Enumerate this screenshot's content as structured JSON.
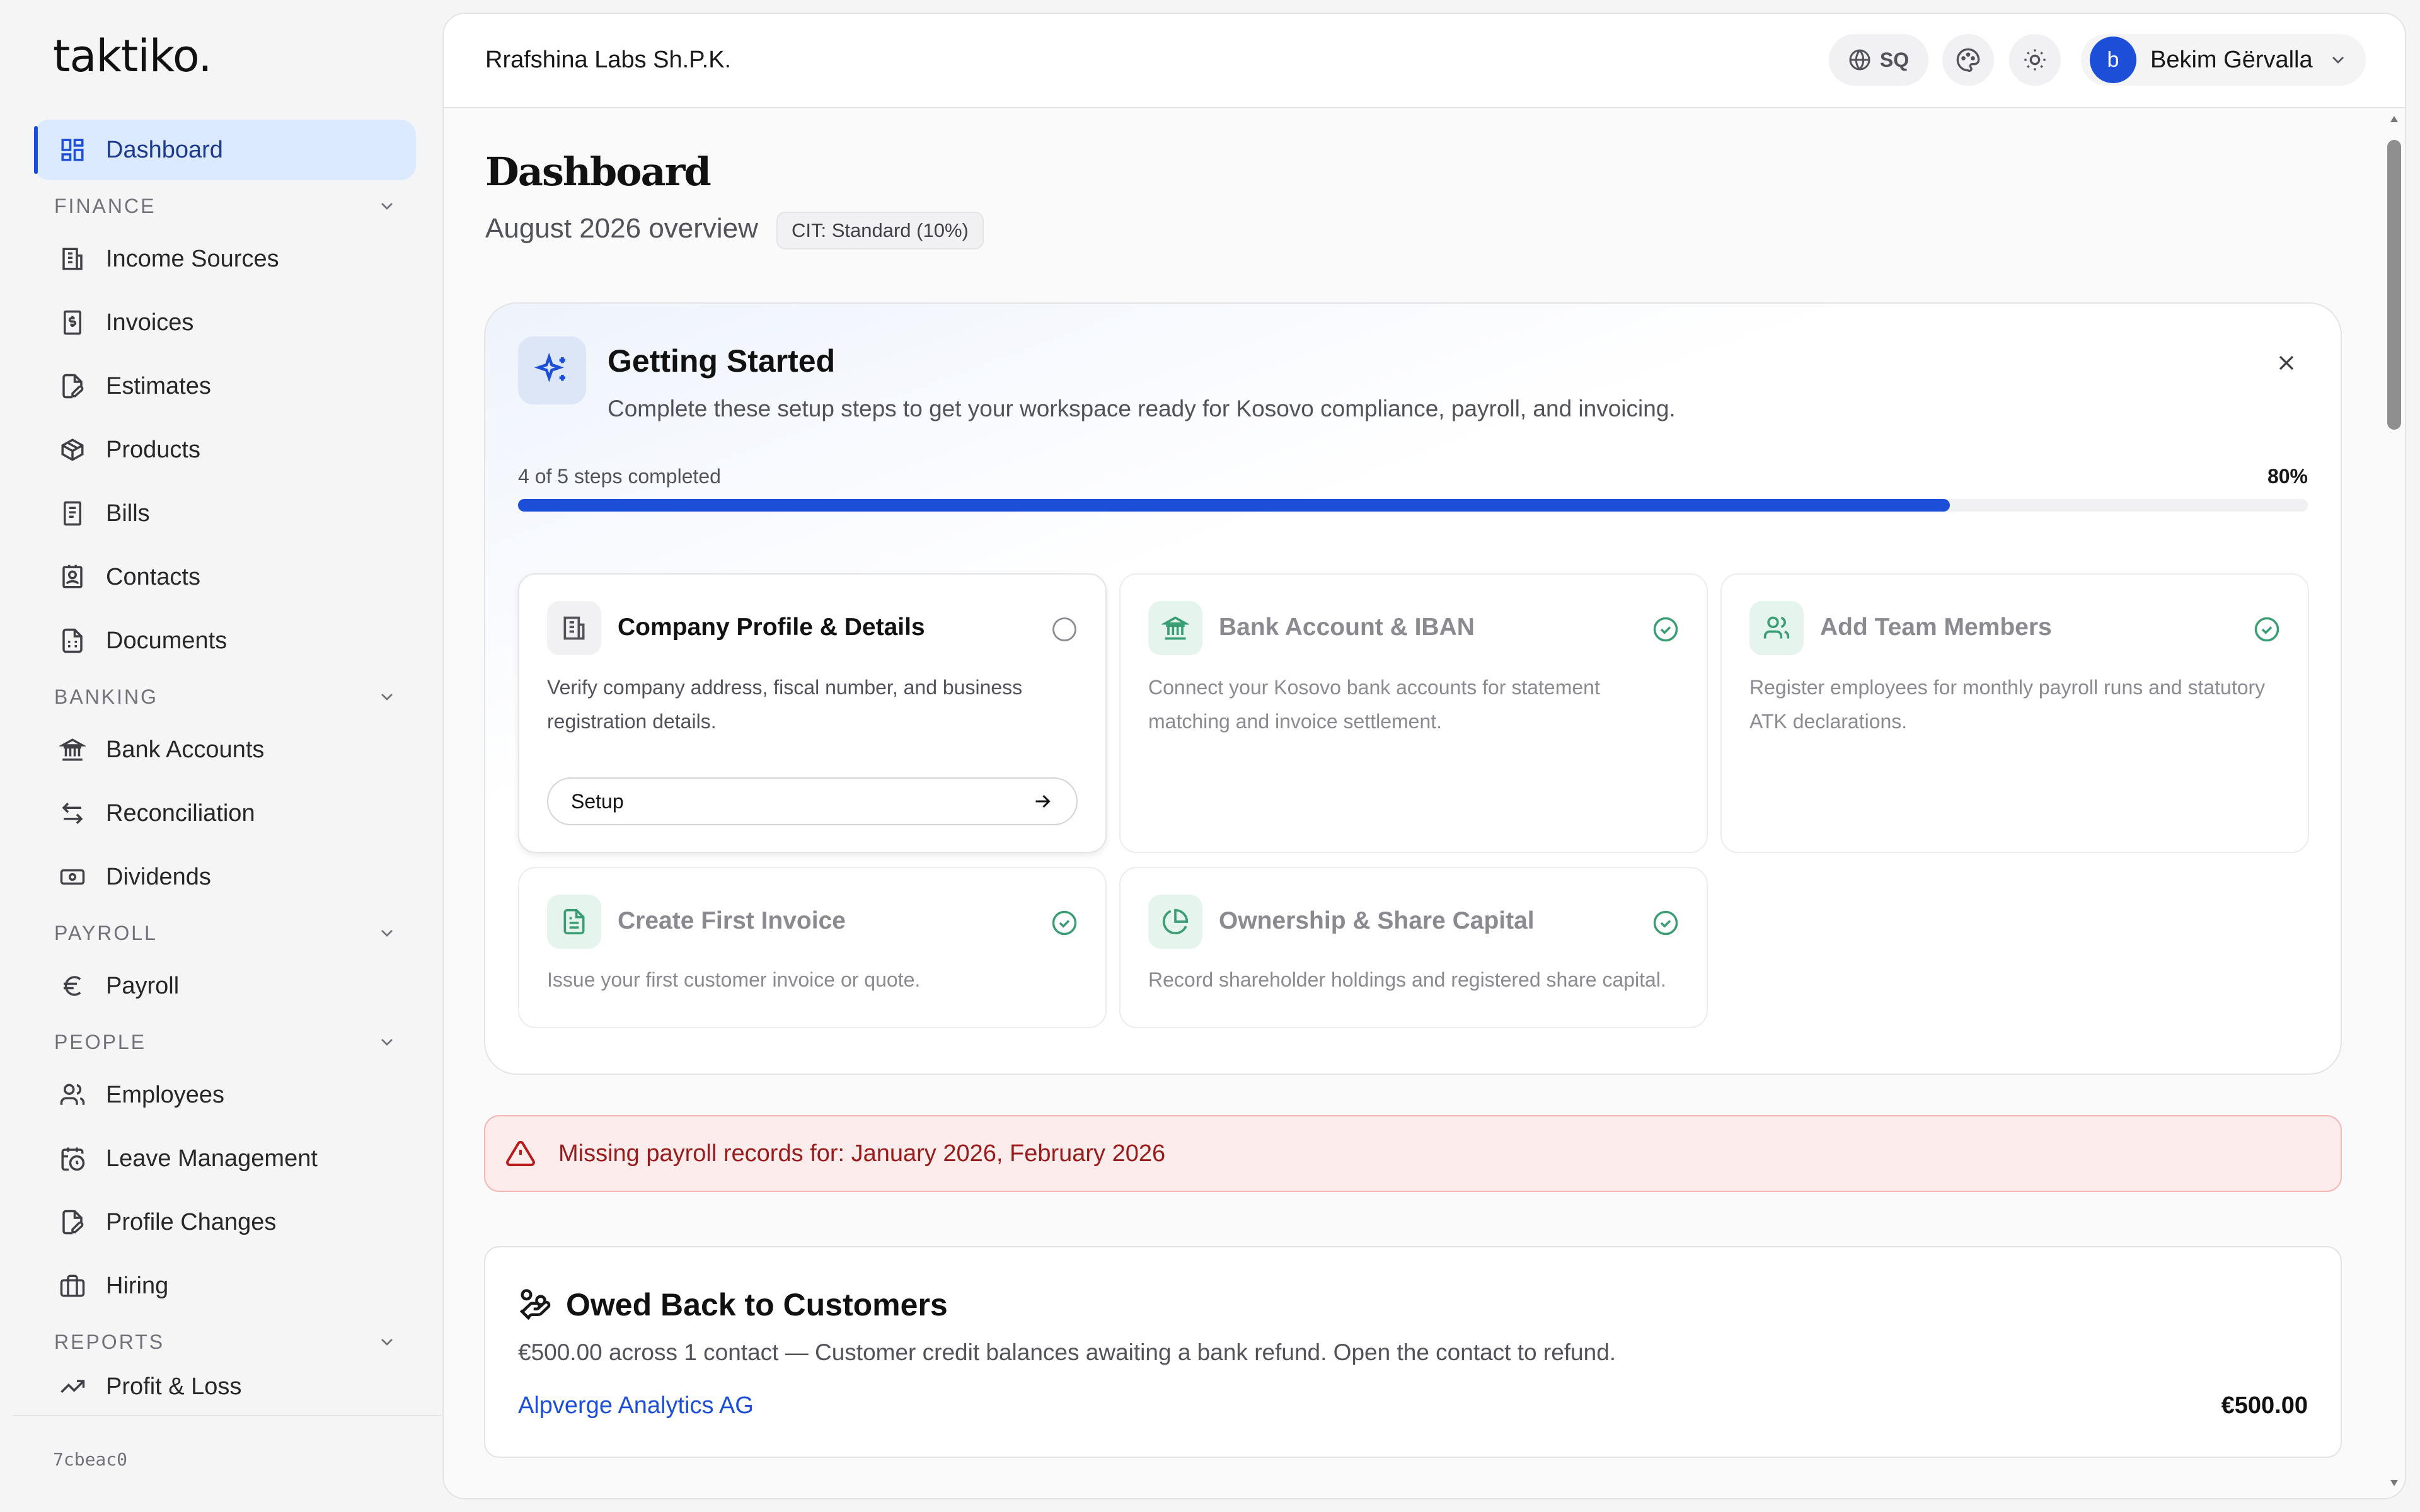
{
  "app": {
    "logo": "taktiko.",
    "version": "7cbeac0"
  },
  "sidebar": {
    "dashboard": {
      "label": "Dashboard",
      "icon": "dashboard-grid-icon"
    },
    "groups": [
      {
        "title": "FINANCE",
        "items": [
          {
            "label": "Income Sources",
            "icon": "building-icon"
          },
          {
            "label": "Invoices",
            "icon": "receipt-dollar-icon"
          },
          {
            "label": "Estimates",
            "icon": "file-pen-icon"
          },
          {
            "label": "Products",
            "icon": "package-icon"
          },
          {
            "label": "Bills",
            "icon": "bill-icon"
          },
          {
            "label": "Contacts",
            "icon": "contact-icon"
          },
          {
            "label": "Documents",
            "icon": "document-icon"
          }
        ]
      },
      {
        "title": "BANKING",
        "items": [
          {
            "label": "Bank Accounts",
            "icon": "bank-icon"
          },
          {
            "label": "Reconciliation",
            "icon": "arrows-swap-icon"
          },
          {
            "label": "Dividends",
            "icon": "banknote-icon"
          }
        ]
      },
      {
        "title": "PAYROLL",
        "items": [
          {
            "label": "Payroll",
            "icon": "euro-icon"
          }
        ]
      },
      {
        "title": "PEOPLE",
        "items": [
          {
            "label": "Employees",
            "icon": "users-icon"
          },
          {
            "label": "Leave Management",
            "icon": "calendar-clock-icon"
          },
          {
            "label": "Profile Changes",
            "icon": "file-edit-icon"
          },
          {
            "label": "Hiring",
            "icon": "briefcase-icon"
          }
        ]
      },
      {
        "title": "REPORTS",
        "items": [
          {
            "label": "Profit & Loss",
            "icon": "trending-up-icon"
          }
        ]
      }
    ]
  },
  "topbar": {
    "org_name": "Rrafshina Labs Sh.P.K.",
    "language": "SQ",
    "user": {
      "initial": "b",
      "name": "Bekim Gërvalla"
    }
  },
  "page": {
    "title": "Dashboard",
    "subtitle": "August 2026 overview",
    "cit_badge": "CIT: Standard (10%)"
  },
  "getting_started": {
    "title": "Getting Started",
    "description": "Complete these setup steps to get your workspace ready for Kosovo compliance, payroll, and invoicing.",
    "progress_label": "4 of 5 steps completed",
    "progress_percent_label": "80%",
    "progress_fraction": 0.8,
    "steps": [
      {
        "title": "Company Profile & Details",
        "description": "Verify company address, fiscal number, and business registration details.",
        "status": "pending",
        "icon": "building-icon",
        "button_label": "Setup"
      },
      {
        "title": "Bank Account & IBAN",
        "description": "Connect your Kosovo bank accounts for statement matching and invoice settlement.",
        "status": "done",
        "icon": "bank-icon"
      },
      {
        "title": "Add Team Members",
        "description": "Register employees for monthly payroll runs and statutory ATK declarations.",
        "status": "done",
        "icon": "users-icon"
      },
      {
        "title": "Create First Invoice",
        "description": "Issue your first customer invoice or quote.",
        "status": "done",
        "icon": "document-icon"
      },
      {
        "title": "Ownership & Share Capital",
        "description": "Record shareholder holdings and registered share capital.",
        "status": "done",
        "icon": "pie-chart-icon"
      }
    ]
  },
  "alert": {
    "message": "Missing payroll records for: January 2026, February 2026"
  },
  "owed": {
    "title": "Owed Back to Customers",
    "description": "€500.00 across 1 contact — Customer credit balances awaiting a bank refund. Open the contact to refund.",
    "contact": "Alpverge Analytics AG",
    "amount": "€500.00"
  },
  "colors": {
    "accent": "#1d4ed8",
    "done": "#3a9d74",
    "alert_bg": "#fdecec",
    "alert_text": "#991b1b"
  }
}
